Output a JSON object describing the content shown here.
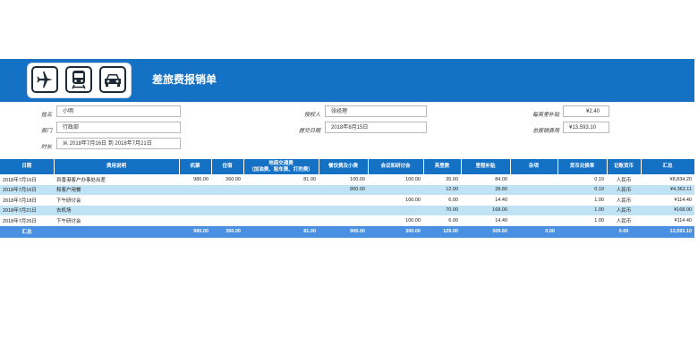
{
  "title": "差旅费报销单",
  "icons": [
    "airplane-icon",
    "train-icon",
    "car-icon"
  ],
  "fields": {
    "name_label": "姓名",
    "name_value": "小明",
    "dept_label": "部门",
    "dept_value": "行政部",
    "period_label": "时长",
    "period_value": "从 2018年7月16日 到 2018年7月21日",
    "approver_label": "授权人",
    "approver_value": "张经理",
    "submit_label": "提交日期",
    "submit_value": "2018年8月15日",
    "allowance_label": "每英里补贴",
    "allowance_value": "¥2.40",
    "total_label": "总报销费用",
    "total_value": "¥13,593.10"
  },
  "columns": [
    "日期",
    "费用说明",
    "机票",
    "住宿",
    "地面交通费\n（加油费、租车费、打的费）",
    "餐饮费及小费",
    "会议和研讨会",
    "英里数",
    "里程补贴",
    "杂项",
    "货币兑换率",
    "记账货币",
    "汇总"
  ],
  "rows": [
    [
      "2018年7月16日",
      "到香港客户办事处出差",
      "980.00",
      "360.00",
      "81.00",
      "100.00",
      "100.00",
      "35.00",
      "84.00",
      "",
      "0.19",
      "人民币",
      "¥8,834.20"
    ],
    [
      "2018年7月16日",
      "和客户用餐",
      "",
      "",
      "",
      "800.00",
      "",
      "12.00",
      "28.80",
      "",
      "0.19",
      "人民币",
      "¥4,362.11"
    ],
    [
      "2018年7月18日",
      "下午研讨会",
      "",
      "",
      "",
      "",
      "100.00",
      "6.00",
      "14.40",
      "",
      "1.00",
      "人民币",
      "¥114.40"
    ],
    [
      "2018年7月21日",
      "去机场",
      "",
      "",
      "",
      "",
      "",
      "70.00",
      "168.00",
      "",
      "1.00",
      "人民币",
      "¥168.00"
    ],
    [
      "2018年7月26日",
      "下午研讨会",
      "",
      "",
      "",
      "",
      "100.00",
      "6.00",
      "14.40",
      "",
      "1.00",
      "人民币",
      "¥114.40"
    ]
  ],
  "totals": [
    "汇总",
    "",
    "980.00",
    "360.00",
    "81.00",
    "900.00",
    "300.00",
    "129.00",
    "309.60",
    "0.00",
    "",
    "0.00",
    "13,593.10"
  ],
  "colors": {
    "header": "#1571c4",
    "alt_row": "#bfe3f5",
    "total_row": "#4a90e2"
  }
}
